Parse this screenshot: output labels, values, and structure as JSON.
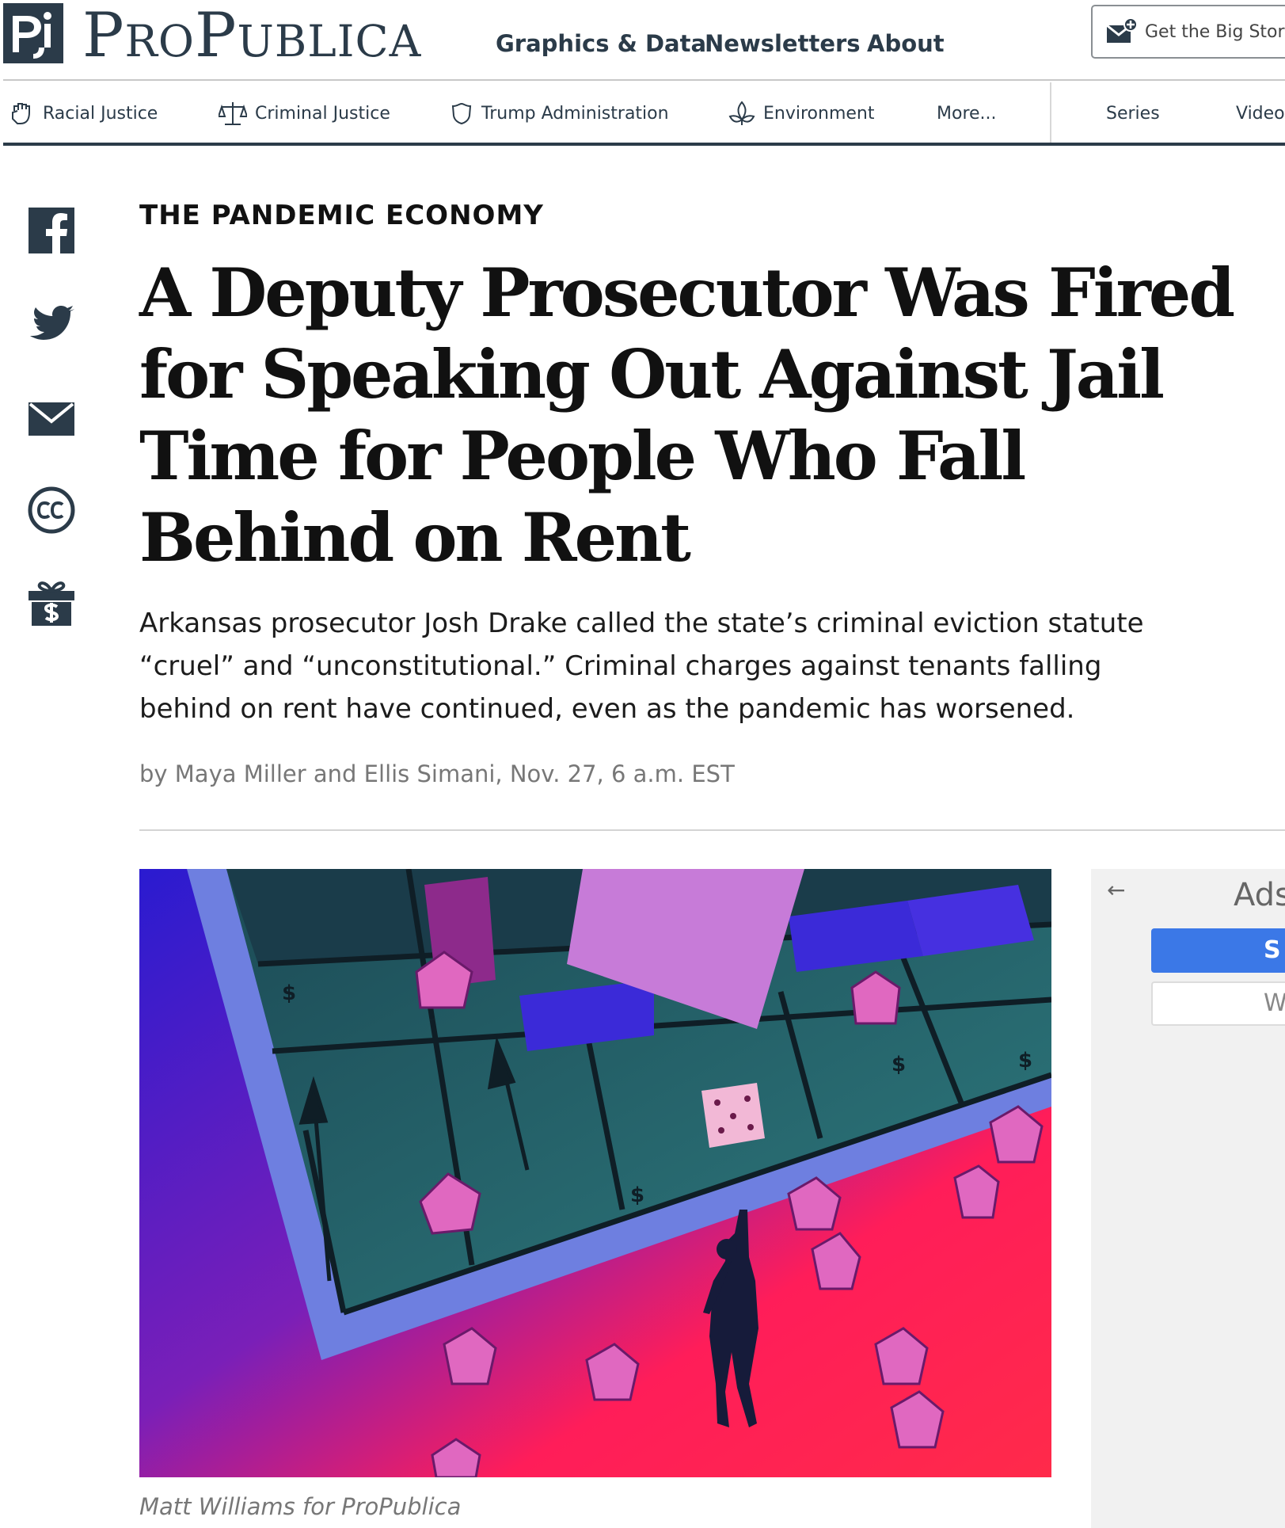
{
  "header": {
    "brand": "ProPublica",
    "nav": [
      "Graphics & Data",
      "Newsletters",
      "About"
    ],
    "newsletter_cta": "Get the Big Story"
  },
  "topics": {
    "items": [
      {
        "label": "Racial Justice",
        "icon": "fist-icon"
      },
      {
        "label": "Criminal Justice",
        "icon": "scales-icon"
      },
      {
        "label": "Trump Administration",
        "icon": "shield-icon"
      },
      {
        "label": "Environment",
        "icon": "leaf-icon"
      },
      {
        "label": "More...",
        "icon": ""
      }
    ],
    "secondary": [
      "Series",
      "Video"
    ]
  },
  "share": [
    "facebook-icon",
    "twitter-icon",
    "email-icon",
    "creative-commons-icon",
    "donate-icon"
  ],
  "article": {
    "kicker": "THE PANDEMIC ECONOMY",
    "headline": "A Deputy Prosecutor Was Fired for Speaking Out Against Jail Time for People Who Fall Behind on Rent",
    "dek": "Arkansas prosecutor Josh Drake called the state’s criminal eviction statute “cruel” and “unconstitutional.” Criminal charges against tenants falling behind on rent have continued, even as the pandemic has worsened.",
    "byline": "by Maya Miller and Ellis Simani, Nov. 27, 6 a.m. EST",
    "caption": "Matt Williams for ProPublica"
  },
  "ad": {
    "back": "←",
    "title": "Ads",
    "button1": "S",
    "button2": "W"
  },
  "colors": {
    "brand": "#2b3b49",
    "art_red": "#ff1d59",
    "art_blue": "#3428d8",
    "art_teal": "#2c6b72",
    "ad_blue": "#3b78e7"
  }
}
